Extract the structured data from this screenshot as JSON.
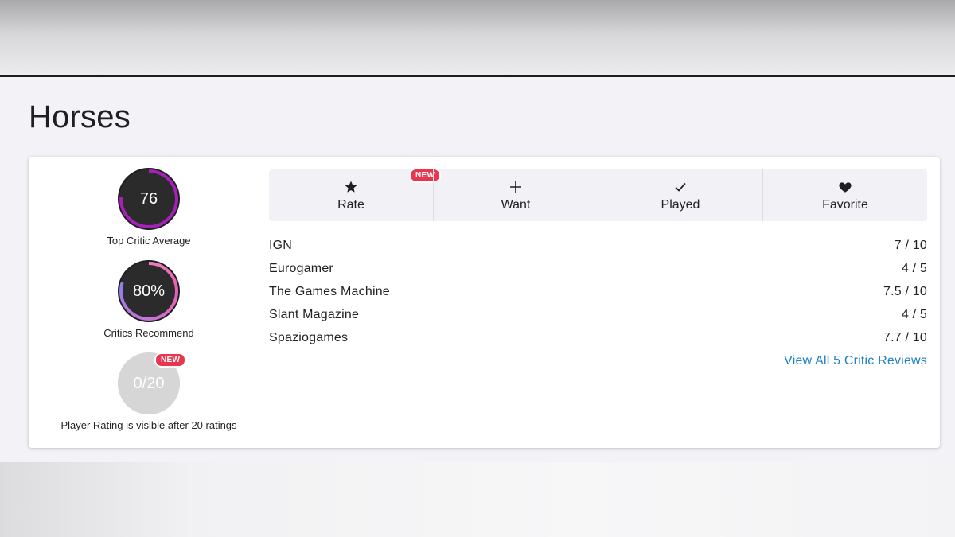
{
  "title": "Horses",
  "scores": {
    "top_critic": {
      "value": "76",
      "label": "Top Critic Average"
    },
    "critics_recommend": {
      "value": "80%",
      "label": "Critics Recommend"
    },
    "player_rating": {
      "value": "0/20",
      "label": "Player Rating is visible after 20 ratings",
      "badge": "NEW"
    }
  },
  "actions": [
    {
      "label": "Rate",
      "icon": "star-icon",
      "badge": "NEW"
    },
    {
      "label": "Want",
      "icon": "plus-icon"
    },
    {
      "label": "Played",
      "icon": "check-icon"
    },
    {
      "label": "Favorite",
      "icon": "heart-icon"
    }
  ],
  "reviews": [
    {
      "outlet": "IGN",
      "score": "7 / 10"
    },
    {
      "outlet": "Eurogamer",
      "score": "4 / 5"
    },
    {
      "outlet": "The Games Machine",
      "score": "7.5 / 10"
    },
    {
      "outlet": "Slant Magazine",
      "score": "4 / 5"
    },
    {
      "outlet": "Spaziogames",
      "score": "7.7 / 10"
    }
  ],
  "view_all": "View All 5 Critic Reviews",
  "colors": {
    "badge": "#e8364f",
    "link": "#1f80c4",
    "top_critic_ring": "#a51fb8"
  }
}
